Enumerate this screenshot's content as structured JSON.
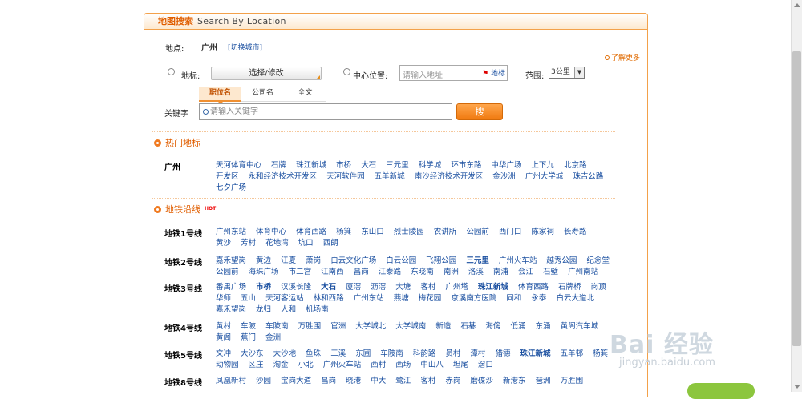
{
  "header": {
    "title_cn": "地图搜索",
    "title_en": "Search By Location"
  },
  "location": {
    "label": "地点:",
    "city": "广州",
    "switch": "[切换城市]"
  },
  "landmark": {
    "label": "地标:",
    "button": "选择/修改"
  },
  "center": {
    "label": "中心位置:",
    "placeholder": "请输入地址",
    "maptag": "地标"
  },
  "range": {
    "label": "范围:",
    "value": "3公里"
  },
  "more": "了解更多",
  "tabs": [
    "职位名",
    "公司名",
    "全文"
  ],
  "keyword": {
    "label": "关键字",
    "placeholder": "请输入关键字"
  },
  "search_button": "搜 索",
  "hot_section": {
    "title": "热门地标",
    "city": "广州",
    "items": [
      "天河体育中心",
      "石牌",
      "珠江新城",
      "市桥",
      "大石",
      "三元里",
      "科学城",
      "环市东路",
      "中华广场",
      "上下九",
      "北京路",
      "开发区",
      "永和经济技术开发区",
      "天河软件园",
      "五羊新城",
      "南沙经济技术开发区",
      "金沙洲",
      "广州大学城",
      "珠吉公路",
      "七夕广场"
    ]
  },
  "metro_section": {
    "title": "地铁沿线",
    "hot": "HOT",
    "lines": [
      {
        "name": "地铁1号线",
        "stations": [
          "广州东站",
          "体育中心",
          "体育西路",
          "杨箕",
          "东山口",
          "烈士陵园",
          "农讲所",
          "公园前",
          "西门口",
          "陈家祠",
          "长寿路",
          "黄沙",
          "芳村",
          "花地湾",
          "坑口",
          "西朗"
        ]
      },
      {
        "name": "地铁2号线",
        "stations": [
          "嘉禾望岗",
          "黄边",
          "江夏",
          "萧岗",
          "白云文化广场",
          "白云公园",
          "飞翔公园",
          "三元里",
          "广州火车站",
          "越秀公园",
          "纪念堂",
          "公园前",
          "海珠广场",
          "市二宫",
          "江南西",
          "昌岗",
          "江泰路",
          "东晓南",
          "南洲",
          "洛溪",
          "南浦",
          "会江",
          "石壁",
          "广州南站"
        ]
      },
      {
        "name": "地铁3号线",
        "stations": [
          "番禺广场",
          "市桥",
          "汉溪长隆",
          "大石",
          "厦滘",
          "沥滘",
          "大塘",
          "客村",
          "广州塔",
          "珠江新城",
          "体育西路",
          "石牌桥",
          "岗顶",
          "华师",
          "五山",
          "天河客运站",
          "林和西路",
          "广州东站",
          "燕塘",
          "梅花园",
          "京溪南方医院",
          "同和",
          "永泰",
          "白云大道北",
          "嘉禾望岗",
          "龙归",
          "人和",
          "机场南"
        ]
      },
      {
        "name": "地铁4号线",
        "stations": [
          "黄村",
          "车陂",
          "车陂南",
          "万胜围",
          "官洲",
          "大学城北",
          "大学城南",
          "新造",
          "石碁",
          "海傍",
          "低涌",
          "东涌",
          "黄阁汽车城",
          "黄阁",
          "蕉门",
          "金洲"
        ]
      },
      {
        "name": "地铁5号线",
        "stations": [
          "文冲",
          "大沙东",
          "大沙地",
          "鱼珠",
          "三溪",
          "东圃",
          "车陂南",
          "科韵路",
          "员村",
          "潭村",
          "猎德",
          "珠江新城",
          "五羊邨",
          "杨箕",
          "动物园",
          "区庄",
          "淘金",
          "小北",
          "广州火车站",
          "西村",
          "西场",
          "中山八",
          "坦尾",
          "滘口"
        ]
      },
      {
        "name": "地铁8号线",
        "stations": [
          "凤凰新村",
          "沙园",
          "宝岗大道",
          "昌岗",
          "晓港",
          "中大",
          "鹭江",
          "客村",
          "赤岗",
          "磨碟沙",
          "新港东",
          "琶洲",
          "万胜围"
        ]
      }
    ],
    "bold": [
      "市桥",
      "大石",
      "珠江新城",
      "三元里"
    ]
  },
  "watermark": {
    "logo": "Bai 经验",
    "url": "jingyan.baidu.com"
  }
}
